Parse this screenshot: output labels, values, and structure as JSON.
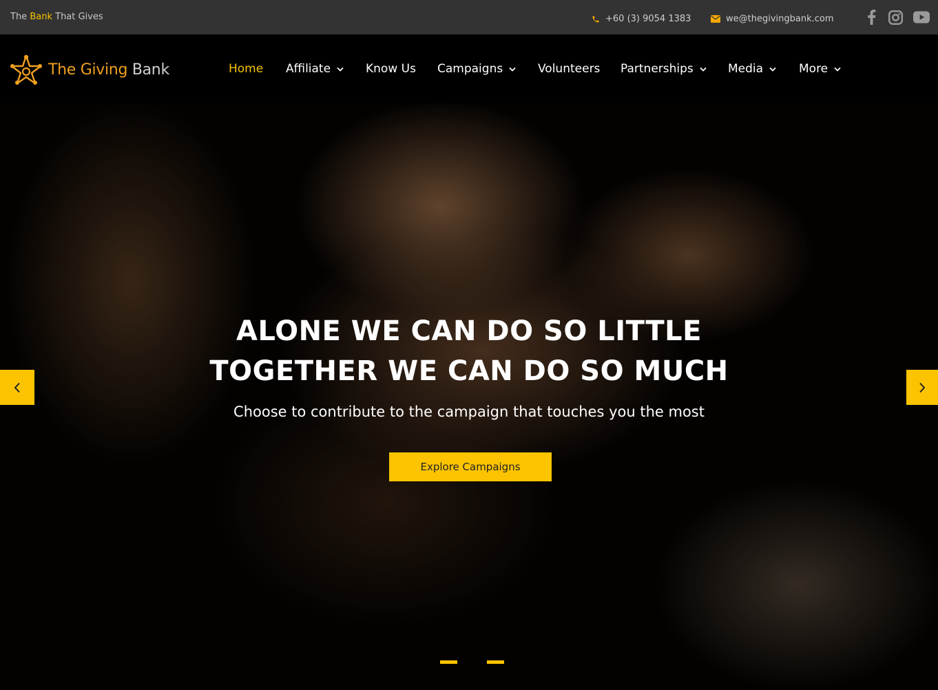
{
  "topbar": {
    "tagline_prefix": "The",
    "tagline_highlight": "Bank",
    "tagline_suffix": "That Gives",
    "phone": "+60 (3) 9054 1383",
    "email": "we@thegivingbank.com",
    "social": [
      "facebook-icon",
      "instagram-icon",
      "youtube-icon"
    ]
  },
  "header": {
    "logo_name": "The Giving",
    "logo_bank": "Bank",
    "nav": [
      {
        "label": "Home",
        "active": true,
        "dropdown": false
      },
      {
        "label": "Affiliate",
        "active": false,
        "dropdown": true
      },
      {
        "label": "Know Us",
        "active": false,
        "dropdown": false
      },
      {
        "label": "Campaigns",
        "active": false,
        "dropdown": true
      },
      {
        "label": "Volunteers",
        "active": false,
        "dropdown": false
      },
      {
        "label": "Partnerships",
        "active": false,
        "dropdown": true
      },
      {
        "label": "Media",
        "active": false,
        "dropdown": true
      },
      {
        "label": "More",
        "active": false,
        "dropdown": true
      }
    ]
  },
  "hero": {
    "headline_line1": "ALONE WE CAN DO SO LITTLE",
    "headline_line2": "TOGETHER WE CAN DO SO MUCH",
    "subline": "Choose to contribute to the campaign that touches you the most",
    "cta_label": "Explore Campaigns",
    "slides_count": 2
  },
  "colors": {
    "accent": "#fcc400",
    "topbar_bg": "#333333",
    "header_bg": "#000000",
    "logo_orange": "#f0a020"
  }
}
